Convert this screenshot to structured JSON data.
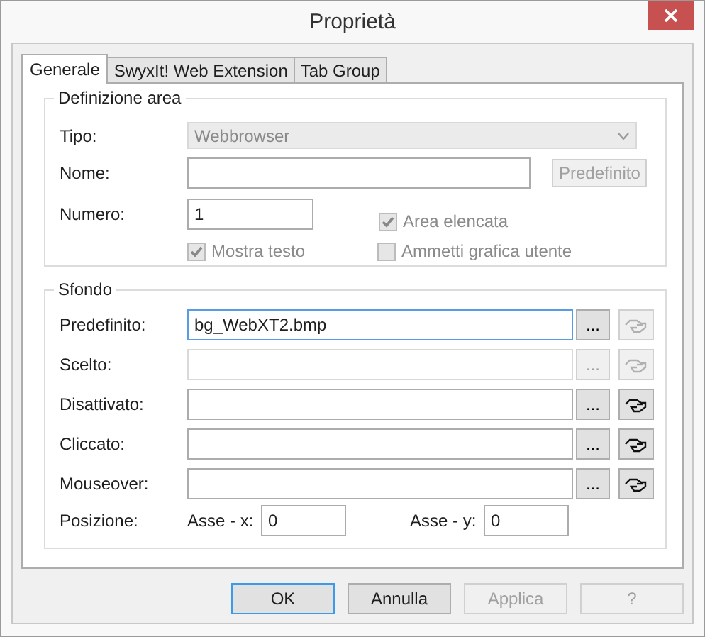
{
  "window": {
    "title": "Proprietà"
  },
  "tabs": [
    {
      "label": "Generale",
      "selected": true
    },
    {
      "label": "SwyxIt! Web Extension",
      "selected": false
    },
    {
      "label": "Tab Group",
      "selected": false
    }
  ],
  "area": {
    "legend": "Definizione area",
    "tipo": {
      "label": "Tipo:",
      "value": "Webbrowser",
      "disabled": true
    },
    "nome": {
      "label": "Nome:",
      "disabled": false,
      "button": {
        "label": "Predefinito",
        "disabled": true
      }
    },
    "numero": {
      "label": "Numero:",
      "value": "1"
    },
    "checkboxes": [
      {
        "label": "Area elencata",
        "checked": true,
        "disabled": true
      },
      {
        "label": "Mostra testo",
        "checked": true,
        "disabled": true
      },
      {
        "label": "Ammetti grafica utente",
        "checked": false,
        "disabled": true
      }
    ]
  },
  "sfondo": {
    "legend": "Sfondo",
    "rows": [
      {
        "label": "Predefinito:",
        "value": "bg_WebXT2.bmp",
        "disabled": false,
        "focused": true,
        "browse": {
          "label": "...",
          "disabled": false
        },
        "pick_disabled": true
      },
      {
        "label": "Scelto:",
        "disabled": true,
        "focused": false,
        "browse": {
          "label": "...",
          "disabled": true
        },
        "pick_disabled": true
      },
      {
        "label": "Disattivato:",
        "disabled": false,
        "focused": false,
        "browse": {
          "label": "...",
          "disabled": false
        },
        "pick_disabled": false
      },
      {
        "label": "Cliccato:",
        "disabled": false,
        "focused": false,
        "browse": {
          "label": "...",
          "disabled": false
        },
        "pick_disabled": false
      },
      {
        "label": "Mouseover:",
        "disabled": false,
        "focused": false,
        "browse": {
          "label": "...",
          "disabled": false
        },
        "pick_disabled": false
      }
    ],
    "position": {
      "label": "Posizione:",
      "axes": [
        {
          "label": "Asse - x:",
          "value": "0"
        },
        {
          "label": "Asse - y:",
          "value": "0"
        }
      ]
    }
  },
  "buttons": [
    {
      "label": "OK",
      "disabled": false,
      "default": true
    },
    {
      "label": "Annulla",
      "disabled": false,
      "default": false
    },
    {
      "label": "Applica",
      "disabled": true,
      "default": false
    },
    {
      "label": "?",
      "disabled": true,
      "default": false
    }
  ]
}
